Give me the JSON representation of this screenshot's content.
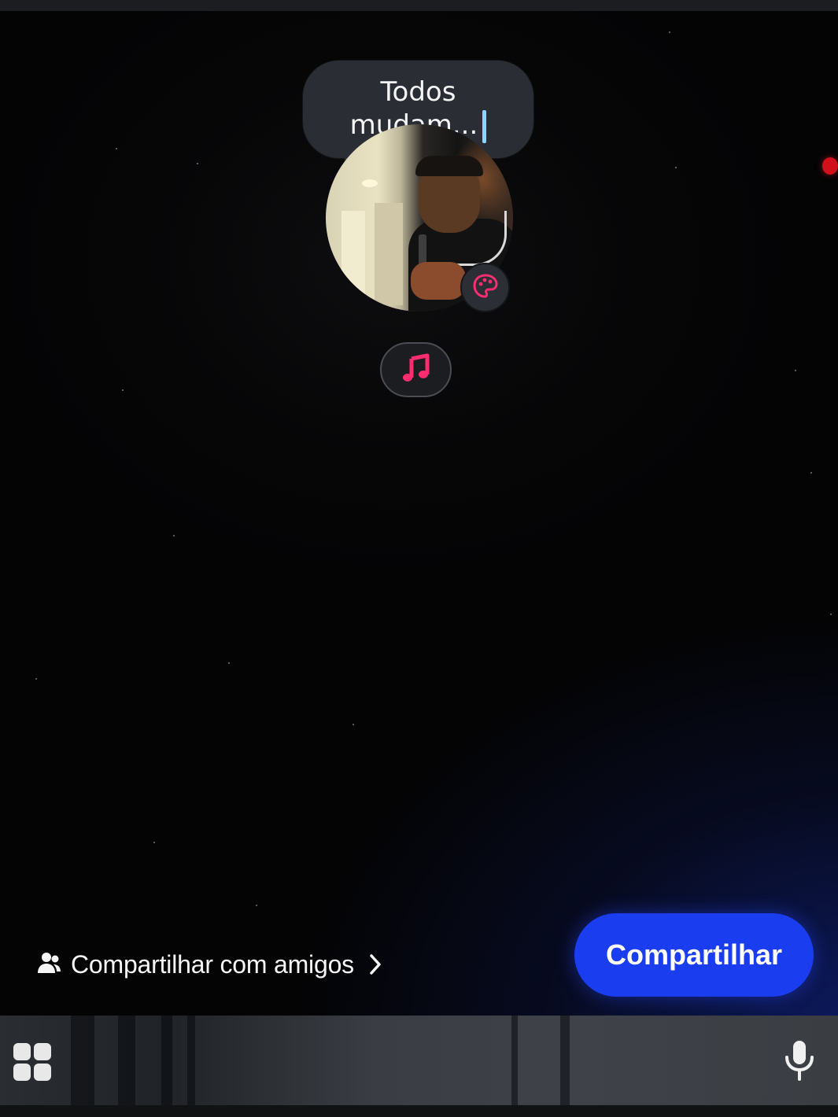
{
  "note": {
    "line1": "Todos",
    "line2": "mudam..."
  },
  "share_friends": {
    "label": "Compartilhar com amigos",
    "icon": "people-icon",
    "chevron_icon": "chevron-right-icon"
  },
  "share_button": {
    "label": "Compartilhar"
  },
  "icons": {
    "palette": "palette-icon",
    "music": "music-note-icon",
    "apps": "app-grid-icon",
    "mic": "microphone-icon"
  },
  "colors": {
    "background": "#050505",
    "bubble": "#2a2d33",
    "share_button": "#1a3df0",
    "accent_pink": "#ff2d6f",
    "record_dot": "#d0101b"
  }
}
